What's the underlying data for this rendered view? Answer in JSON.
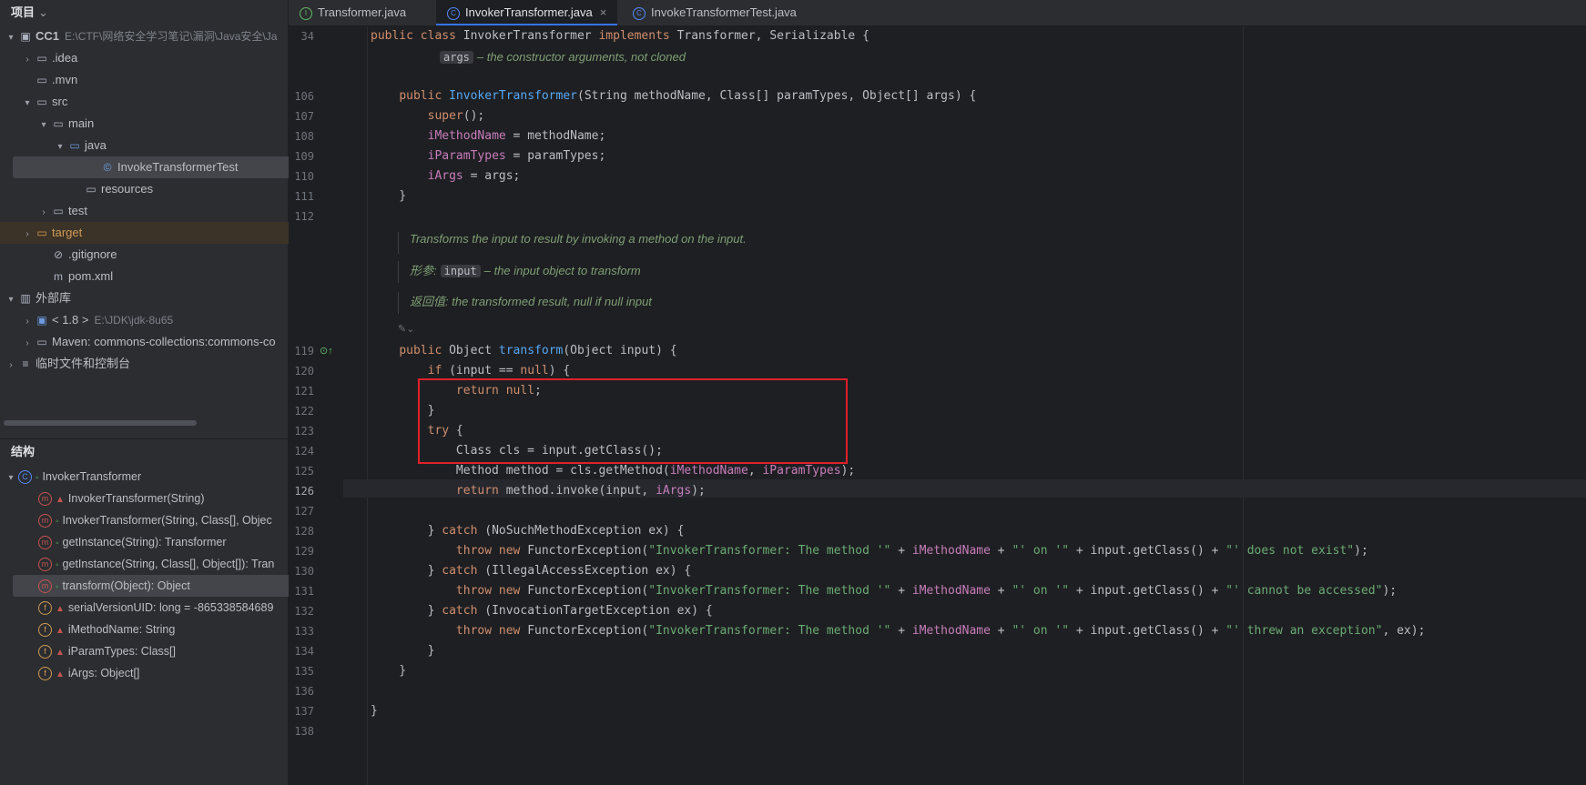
{
  "project_panel": {
    "title": "项目",
    "tree": [
      {
        "label": "CC1",
        "path": "E:\\CTF\\网络安全学习笔记\\漏洞\\Java安全\\Ja",
        "depth": 0,
        "arrow": "▾",
        "icon": "module-folder-icon",
        "bold": true
      },
      {
        "label": ".idea",
        "depth": 1,
        "arrow": "›",
        "icon": "folder-icon"
      },
      {
        "label": ".mvn",
        "depth": 1,
        "arrow": "",
        "icon": "folder-icon"
      },
      {
        "label": "src",
        "depth": 1,
        "arrow": "▾",
        "icon": "folder-icon"
      },
      {
        "label": "main",
        "depth": 2,
        "arrow": "▾",
        "icon": "folder-icon"
      },
      {
        "label": "java",
        "depth": 3,
        "arrow": "▾",
        "icon": "source-folder-icon"
      },
      {
        "label": "InvokeTransformerTest",
        "depth": 5,
        "arrow": "",
        "icon": "java-class-icon",
        "selected": true
      },
      {
        "label": "resources",
        "depth": 4,
        "arrow": "",
        "icon": "resources-folder-icon"
      },
      {
        "label": "test",
        "depth": 2,
        "arrow": "›",
        "icon": "folder-icon"
      },
      {
        "label": "target",
        "depth": 1,
        "arrow": "›",
        "icon": "excluded-folder-icon",
        "excluded": true
      },
      {
        "label": ".gitignore",
        "depth": 2,
        "arrow": "",
        "icon": "ignore-file-icon"
      },
      {
        "label": "pom.xml",
        "depth": 2,
        "arrow": "",
        "icon": "maven-file-icon"
      },
      {
        "label": "外部库",
        "depth": 0,
        "arrow": "▾",
        "icon": "library-icon"
      },
      {
        "label": "< 1.8 >",
        "path": "E:\\JDK\\jdk-8u65",
        "depth": 1,
        "arrow": "›",
        "icon": "jdk-icon"
      },
      {
        "label": "Maven: commons-collections:commons-co",
        "depth": 1,
        "arrow": "›",
        "icon": "library-jar-icon"
      },
      {
        "label": "临时文件和控制台",
        "depth": 0,
        "arrow": "›",
        "icon": "scratch-icon"
      }
    ]
  },
  "structure_panel": {
    "title": "结构",
    "items": [
      {
        "label": "InvokerTransformer",
        "depth": 0,
        "badge": "C",
        "kind": "class",
        "access": "public",
        "arrow": "▾"
      },
      {
        "label": "InvokerTransformer(String)",
        "depth": 1,
        "badge": "m",
        "kind": "method",
        "access": "private"
      },
      {
        "label": "InvokerTransformer(String, Class[], Objec",
        "depth": 1,
        "badge": "m",
        "kind": "method",
        "access": "public"
      },
      {
        "label": "getInstance(String): Transformer",
        "depth": 1,
        "badge": "m",
        "kind": "method",
        "access": "public"
      },
      {
        "label": "getInstance(String, Class[], Object[]): Tran",
        "depth": 1,
        "badge": "m",
        "kind": "method",
        "access": "public"
      },
      {
        "label": "transform(Object): Object",
        "depth": 1,
        "badge": "m",
        "kind": "method",
        "access": "public",
        "selected": true
      },
      {
        "label": "serialVersionUID: long = -865338584689",
        "depth": 1,
        "badge": "f",
        "kind": "field",
        "access": "private"
      },
      {
        "label": "iMethodName: String",
        "depth": 1,
        "badge": "f",
        "kind": "field",
        "access": "private"
      },
      {
        "label": "iParamTypes: Class[]",
        "depth": 1,
        "badge": "f",
        "kind": "field",
        "access": "private"
      },
      {
        "label": "iArgs: Object[]",
        "depth": 1,
        "badge": "f",
        "kind": "field",
        "access": "private"
      }
    ]
  },
  "tabs": [
    {
      "label": "Transformer.java",
      "icon": "interface-icon",
      "active": false
    },
    {
      "label": "InvokerTransformer.java",
      "icon": "class-icon",
      "active": true,
      "close": "×"
    },
    {
      "label": "InvokeTransformerTest.java",
      "icon": "class-icon",
      "active": false
    }
  ],
  "editor": {
    "line_numbers": [
      "34",
      "106",
      "107",
      "108",
      "109",
      "110",
      "111",
      "112",
      "119",
      "120",
      "121",
      "122",
      "123",
      "124",
      "125",
      "126",
      "127",
      "128",
      "129",
      "130",
      "131",
      "132",
      "133",
      "134",
      "135",
      "136",
      "137",
      "138"
    ],
    "current_line": "126",
    "sticky_header": "public class InvokerTransformer implements Transformer, Serializable {",
    "doc_args_param": "args",
    "doc_args_text": "– the constructor arguments, not cloned",
    "doc_transform_summary": "Transforms the input to result by invoking a method on the input.",
    "doc_params_label": "形参:",
    "doc_params_name": "input",
    "doc_params_text": "– the input object to transform",
    "doc_return_label": "返回值:",
    "doc_return_text": "the transformed result, null if null input",
    "highlight_box_color": "#e0202a"
  },
  "colors": {
    "background": "#1e1f22",
    "panel": "#2b2d30",
    "keyword": "#cf8e6d",
    "field": "#c77dbb",
    "method_decl": "#56a8f5",
    "string": "#6aab73",
    "doc": "#7f9f74"
  }
}
